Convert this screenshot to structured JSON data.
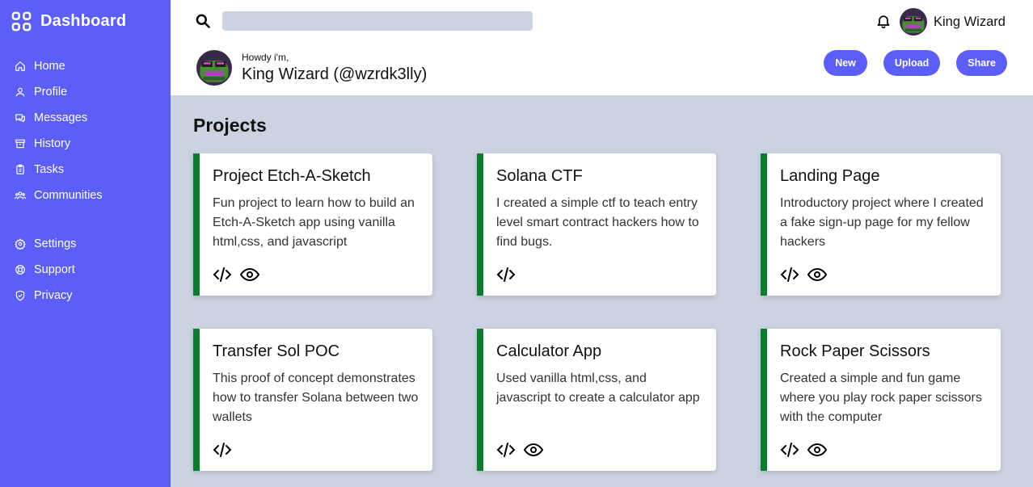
{
  "sidebar": {
    "brand": "Dashboard",
    "primary": [
      {
        "label": "Home",
        "icon": "home-icon"
      },
      {
        "label": "Profile",
        "icon": "user-icon"
      },
      {
        "label": "Messages",
        "icon": "chat-icon"
      },
      {
        "label": "History",
        "icon": "archive-icon"
      },
      {
        "label": "Tasks",
        "icon": "clipboard-icon"
      },
      {
        "label": "Communities",
        "icon": "users-icon"
      }
    ],
    "secondary": [
      {
        "label": "Settings",
        "icon": "gear-icon"
      },
      {
        "label": "Support",
        "icon": "lifebuoy-icon"
      },
      {
        "label": "Privacy",
        "icon": "shield-icon"
      }
    ]
  },
  "header": {
    "search": {
      "value": "",
      "placeholder": ""
    },
    "user": "King Wizard",
    "greeting": "Howdy i'm,",
    "full_name": "King Wizard (@wzrdk3lly)",
    "buttons": {
      "new": "New",
      "upload": "Upload",
      "share": "Share"
    }
  },
  "colors": {
    "sidebar": "#5b5ef7",
    "content_bg": "#cbd2e1",
    "card_accent": "#0a7c2e"
  },
  "main": {
    "title": "Projects",
    "projects": [
      {
        "title": "Project Etch-A-Sketch",
        "desc": "Fun project to learn how to build an Etch-A-Sketch app using vanilla html,css, and javascript",
        "icons": [
          "code-icon",
          "eye-icon"
        ]
      },
      {
        "title": "Solana CTF",
        "desc": "I created a simple ctf to teach entry level smart contract hackers how to find bugs.",
        "icons": [
          "code-icon"
        ]
      },
      {
        "title": "Landing Page",
        "desc": "Introductory project where I created a fake sign-up page for my fellow hackers",
        "icons": [
          "code-icon",
          "eye-icon"
        ]
      },
      {
        "title": "Transfer Sol POC",
        "desc": "This proof of concept demonstrates how to transfer Solana between two wallets",
        "icons": [
          "code-icon"
        ]
      },
      {
        "title": "Calculator App",
        "desc": "Used vanilla html,css, and javascript to create a calculator app",
        "icons": [
          "code-icon",
          "eye-icon"
        ]
      },
      {
        "title": "Rock Paper Scissors",
        "desc": "Created a simple and fun game where you play rock paper scissors with the computer",
        "icons": [
          "code-icon",
          "eye-icon"
        ]
      }
    ]
  }
}
